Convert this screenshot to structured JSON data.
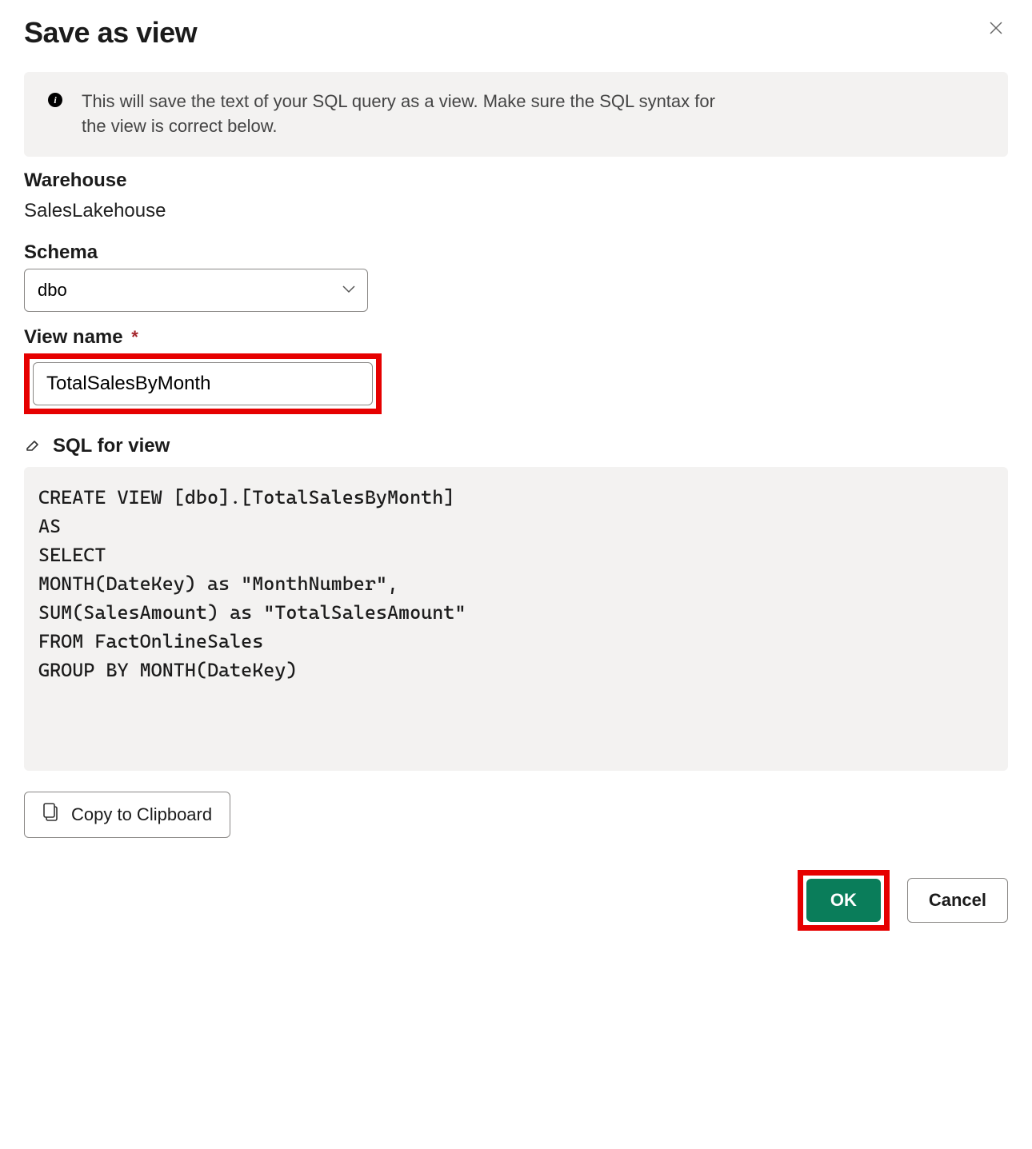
{
  "dialog": {
    "title": "Save as view",
    "info_text": "This will save the text of your SQL query as a view. Make sure the SQL syntax for the view is correct below."
  },
  "warehouse": {
    "label": "Warehouse",
    "value": "SalesLakehouse"
  },
  "schema": {
    "label": "Schema",
    "selected": "dbo"
  },
  "view_name": {
    "label": "View name",
    "required_marker": "*",
    "value": "TotalSalesByMonth"
  },
  "sql": {
    "heading": "SQL for view",
    "code": "CREATE VIEW [dbo].[TotalSalesByMonth]\nAS\nSELECT\nMONTH(DateKey) as \"MonthNumber\",\nSUM(SalesAmount) as \"TotalSalesAmount\"\nFROM FactOnlineSales\nGROUP BY MONTH(DateKey)"
  },
  "buttons": {
    "copy": "Copy to Clipboard",
    "ok": "OK",
    "cancel": "Cancel"
  }
}
